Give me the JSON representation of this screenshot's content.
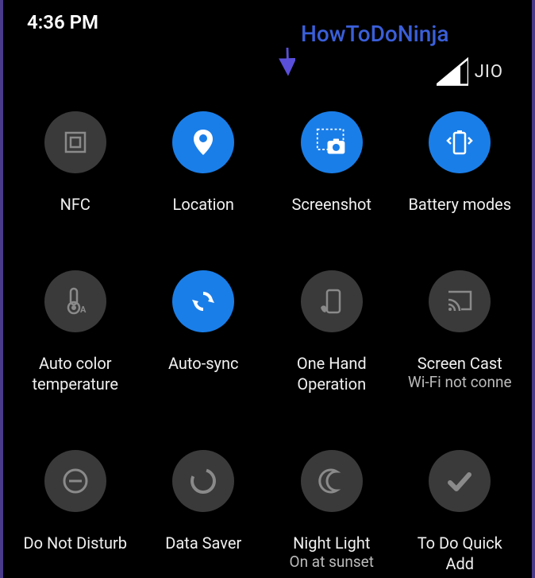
{
  "status": {
    "time": "4:36 PM",
    "carrier": "JIO"
  },
  "annotation": {
    "watermark": "HowToDoNinja"
  },
  "tiles": [
    {
      "label": "NFC",
      "sublabel": "",
      "active": false,
      "icon": "nfc-icon"
    },
    {
      "label": "Location",
      "sublabel": "",
      "active": true,
      "icon": "location-icon"
    },
    {
      "label": "Screenshot",
      "sublabel": "",
      "active": true,
      "icon": "screenshot-icon"
    },
    {
      "label": "Battery modes",
      "sublabel": "",
      "active": true,
      "icon": "battery-icon"
    },
    {
      "label": "Auto color\ntemperature",
      "sublabel": "",
      "active": false,
      "icon": "thermometer-icon"
    },
    {
      "label": "Auto-sync",
      "sublabel": "",
      "active": true,
      "icon": "sync-icon"
    },
    {
      "label": "One Hand\nOperation",
      "sublabel": "",
      "active": false,
      "icon": "onehand-icon"
    },
    {
      "label": "Screen Cast",
      "sublabel": "Wi-Fi not conne",
      "active": false,
      "icon": "cast-icon"
    },
    {
      "label": "Do Not Disturb",
      "sublabel": "",
      "active": false,
      "icon": "dnd-icon"
    },
    {
      "label": "Data Saver",
      "sublabel": "",
      "active": false,
      "icon": "datasaver-icon"
    },
    {
      "label": "Night Light",
      "sublabel": "On at sunset",
      "active": false,
      "icon": "nightlight-icon"
    },
    {
      "label": "To Do Quick\nAdd",
      "sublabel": "",
      "active": false,
      "icon": "todo-icon"
    }
  ]
}
